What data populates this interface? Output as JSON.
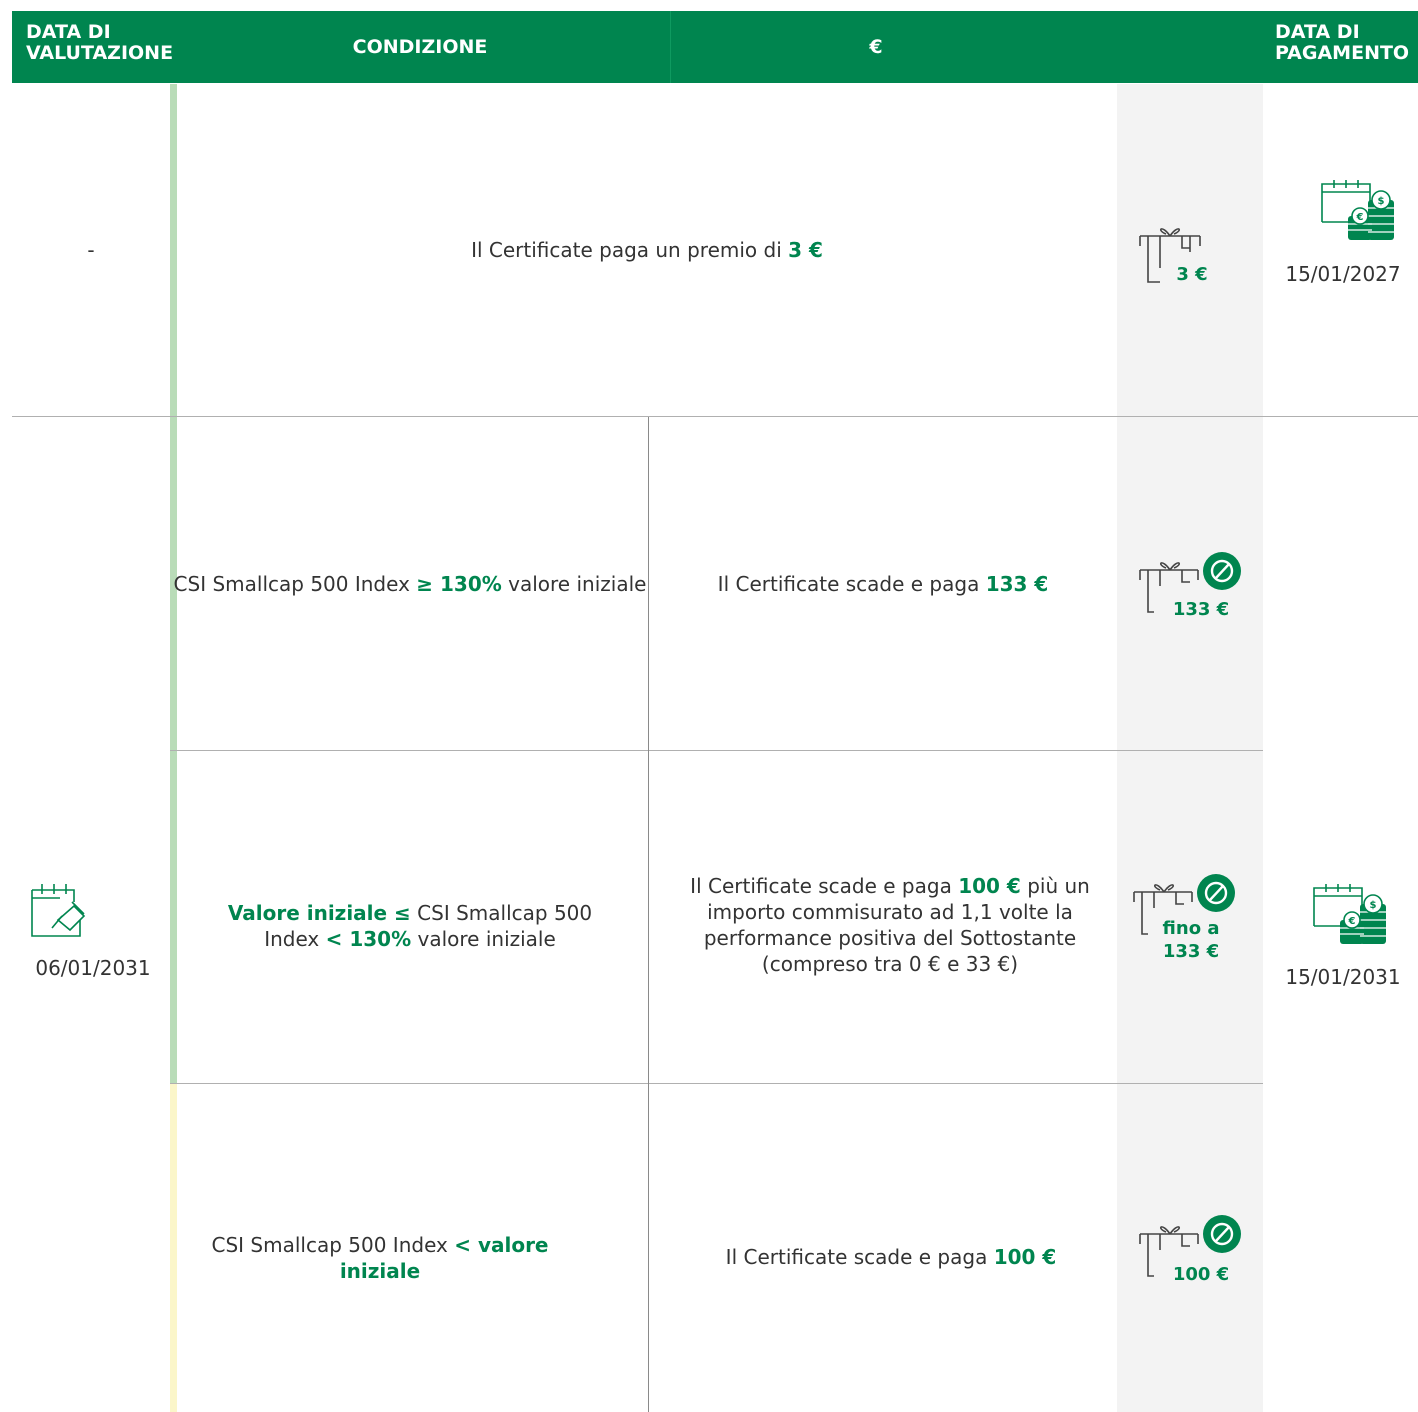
{
  "header": {
    "col1": "DATA DI VALUTAZIONE",
    "col2": "CONDIZIONE",
    "col3": "€",
    "col4": "DATA DI PAGAMENTO"
  },
  "row1": {
    "eval_date": "-",
    "text_pre": "Il Certificate paga un premio di",
    "text_value": "3 €",
    "icon_amount": "3 €",
    "pay_date": "15/01/2027"
  },
  "row2": {
    "eval_date": "06/01/2031",
    "pay_date": "15/01/2031",
    "scenarios": [
      {
        "cond_pre": "CSI Smallcap 500 Index",
        "cond_bold": "≥ 130%",
        "cond_post": "valore iniziale",
        "pay_pre": "Il Certificate scade e paga",
        "pay_bold": "133 €",
        "icon_amount": "133 €"
      },
      {
        "cond_bold1": "Valore iniziale ≤",
        "cond_mid": "CSI Smallcap 500 Index",
        "cond_bold2": "< 130%",
        "cond_post": "valore iniziale",
        "pay_pre": "Il Certificate scade e paga",
        "pay_bold": "100 €",
        "pay_post": "più un importo commisurato ad 1,1 volte la performance positiva del Sottostante (compreso tra 0 € e 33 €)",
        "icon_amount_line1": "fino a",
        "icon_amount_line2": "133 €"
      },
      {
        "cond_pre": "CSI Smallcap 500 Index",
        "cond_bold": "< valore iniziale",
        "pay_pre": "Il Certificate scade e paga",
        "pay_bold": "100 €",
        "icon_amount": "100 €"
      }
    ]
  },
  "icons": {
    "gift": "gift-icon",
    "target": "target-check-icon",
    "calendar_coins": "calendar-coins-icon",
    "calendar_pin": "calendar-pin-icon"
  },
  "colors": {
    "brand_green": "#00854f",
    "light_green_bar": "#b9dcb8",
    "light_yellow_bar": "#fbf6c9",
    "gray_column": "#f3f3f3"
  }
}
